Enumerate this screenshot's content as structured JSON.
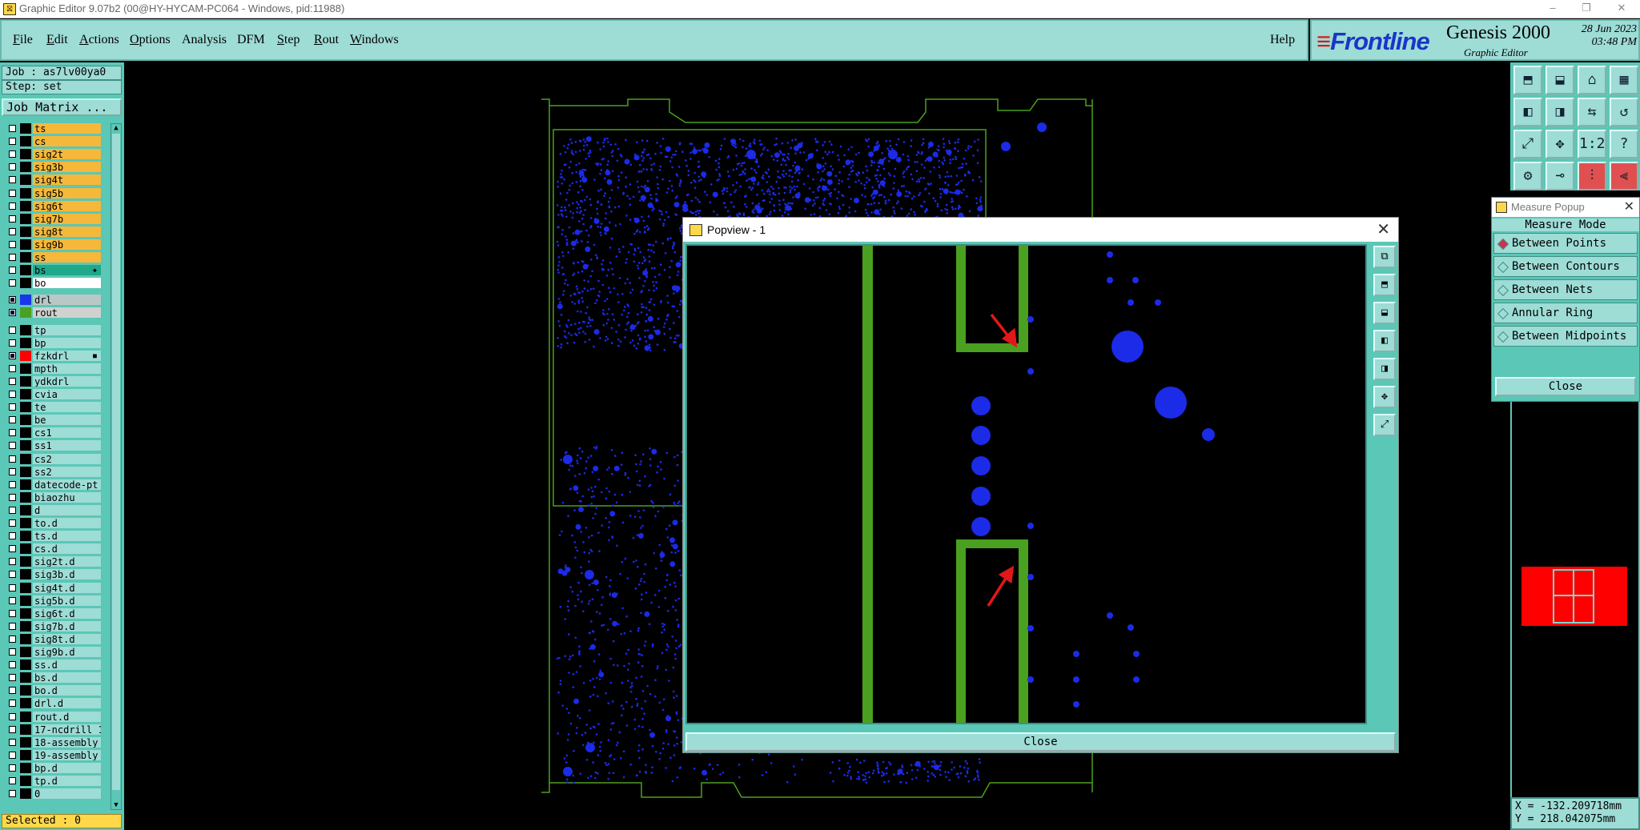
{
  "window": {
    "title": "Graphic Editor 9.07b2 (00@HY-HYCAM-PC064 - Windows, pid:11988)",
    "controls": [
      "–",
      "❐",
      "✕"
    ]
  },
  "menu": {
    "items": [
      {
        "label": "File",
        "underline": "F",
        "rest": "ile"
      },
      {
        "label": "Edit",
        "underline": "E",
        "rest": "dit"
      },
      {
        "label": "Actions",
        "underline": "A",
        "rest": "ctions"
      },
      {
        "label": "Options",
        "underline": "O",
        "rest": "ptions"
      },
      {
        "label": "Analysis",
        "underline": "",
        "rest": "Analysis"
      },
      {
        "label": "DFM",
        "underline": "",
        "rest": "DFM"
      },
      {
        "label": "Step",
        "underline": "S",
        "rest": "tep"
      },
      {
        "label": "Rout",
        "underline": "R",
        "rest": "out"
      },
      {
        "label": "Windows",
        "underline": "W",
        "rest": "indows"
      }
    ],
    "help": "Help"
  },
  "brand": {
    "logo": "Frontline",
    "product": "Genesis 2000",
    "subtitle": "Graphic Editor",
    "date": "28 Jun 2023",
    "time": "03:48 PM"
  },
  "left_panel": {
    "job": "Job : as7lv00ya0",
    "step": "Step: set",
    "job_matrix": "Job Matrix ...",
    "selected": "Selected : 0",
    "layers": [
      {
        "name": "ts",
        "color": "#f5b83a",
        "swatch": "#000000"
      },
      {
        "name": "cs",
        "color": "#f5b83a",
        "swatch": "#000000"
      },
      {
        "name": "sig2t",
        "color": "#f5b83a",
        "swatch": "#000000"
      },
      {
        "name": "sig3b",
        "color": "#f5b83a",
        "swatch": "#000000"
      },
      {
        "name": "sig4t",
        "color": "#f5b83a",
        "swatch": "#000000"
      },
      {
        "name": "sig5b",
        "color": "#f5b83a",
        "swatch": "#000000"
      },
      {
        "name": "sig6t",
        "color": "#f5b83a",
        "swatch": "#000000"
      },
      {
        "name": "sig7b",
        "color": "#f5b83a",
        "swatch": "#000000"
      },
      {
        "name": "sig8t",
        "color": "#f5b83a",
        "swatch": "#000000"
      },
      {
        "name": "sig9b",
        "color": "#f5b83a",
        "swatch": "#000000"
      },
      {
        "name": "ss",
        "color": "#f5b83a",
        "swatch": "#000000"
      },
      {
        "name": "bs",
        "color": "#1fa88a",
        "swatch": "#000000",
        "marker": "◆"
      },
      {
        "name": "bo",
        "color": "#ffffff",
        "swatch": "#000000"
      },
      {
        "name": "drl",
        "color": "#b9c8c6",
        "swatch": "#1b35e8",
        "checked": true,
        "gap": true
      },
      {
        "name": "rout",
        "color": "#cfd2cf",
        "swatch": "#4aa020",
        "checked": true
      },
      {
        "name": "tp",
        "color": "#9edcd6",
        "swatch": "#000000",
        "gap": true
      },
      {
        "name": "bp",
        "color": "#9edcd6",
        "swatch": "#000000"
      },
      {
        "name": "fzkdrl",
        "color": "#9edcd6",
        "swatch": "#ff0000",
        "checked": true,
        "marker": "■"
      },
      {
        "name": "mpth",
        "color": "#9edcd6",
        "swatch": "#000000"
      },
      {
        "name": "ydkdrl",
        "color": "#9edcd6",
        "swatch": "#000000"
      },
      {
        "name": "cvia",
        "color": "#9edcd6",
        "swatch": "#000000"
      },
      {
        "name": "te",
        "color": "#9edcd6",
        "swatch": "#000000"
      },
      {
        "name": "be",
        "color": "#9edcd6",
        "swatch": "#000000"
      },
      {
        "name": "cs1",
        "color": "#9edcd6",
        "swatch": "#000000"
      },
      {
        "name": "ss1",
        "color": "#9edcd6",
        "swatch": "#000000"
      },
      {
        "name": "cs2",
        "color": "#9edcd6",
        "swatch": "#000000"
      },
      {
        "name": "ss2",
        "color": "#9edcd6",
        "swatch": "#000000"
      },
      {
        "name": "datecode-pt",
        "color": "#9edcd6",
        "swatch": "#000000"
      },
      {
        "name": "biaozhu",
        "color": "#9edcd6",
        "swatch": "#000000"
      },
      {
        "name": "d",
        "color": "#9edcd6",
        "swatch": "#000000"
      },
      {
        "name": "to.d",
        "color": "#9edcd6",
        "swatch": "#000000"
      },
      {
        "name": "ts.d",
        "color": "#9edcd6",
        "swatch": "#000000"
      },
      {
        "name": "cs.d",
        "color": "#9edcd6",
        "swatch": "#000000"
      },
      {
        "name": "sig2t.d",
        "color": "#9edcd6",
        "swatch": "#000000"
      },
      {
        "name": "sig3b.d",
        "color": "#9edcd6",
        "swatch": "#000000"
      },
      {
        "name": "sig4t.d",
        "color": "#9edcd6",
        "swatch": "#000000"
      },
      {
        "name": "sig5b.d",
        "color": "#9edcd6",
        "swatch": "#000000"
      },
      {
        "name": "sig6t.d",
        "color": "#9edcd6",
        "swatch": "#000000"
      },
      {
        "name": "sig7b.d",
        "color": "#9edcd6",
        "swatch": "#000000"
      },
      {
        "name": "sig8t.d",
        "color": "#9edcd6",
        "swatch": "#000000"
      },
      {
        "name": "sig9b.d",
        "color": "#9edcd6",
        "swatch": "#000000"
      },
      {
        "name": "ss.d",
        "color": "#9edcd6",
        "swatch": "#000000"
      },
      {
        "name": "bs.d",
        "color": "#9edcd6",
        "swatch": "#000000"
      },
      {
        "name": "bo.d",
        "color": "#9edcd6",
        "swatch": "#000000"
      },
      {
        "name": "drl.d",
        "color": "#9edcd6",
        "swatch": "#000000"
      },
      {
        "name": "rout.d",
        "color": "#9edcd6",
        "swatch": "#000000"
      },
      {
        "name": "17-ncdrill_1",
        "color": "#9edcd6",
        "swatch": "#000000"
      },
      {
        "name": "18-assembly",
        "color": "#9edcd6",
        "swatch": "#000000"
      },
      {
        "name": "19-assembly",
        "color": "#9edcd6",
        "swatch": "#000000"
      },
      {
        "name": "bp.d",
        "color": "#9edcd6",
        "swatch": "#000000"
      },
      {
        "name": "tp.d",
        "color": "#9edcd6",
        "swatch": "#000000"
      },
      {
        "name": "0",
        "color": "#9edcd6",
        "swatch": "#000000"
      }
    ]
  },
  "toolbar": {
    "icons": [
      "zoom-home-icon",
      "zoom-fit-icon",
      "home-icon",
      "grid-icon",
      "pan-left-icon",
      "pan-right-icon",
      "zoom-prev-icon",
      "redraw-icon",
      "fit-screen-icon",
      "center-icon",
      "scale-icon",
      "help-icon",
      "settings-icon",
      "measure-icon",
      "snap-icon",
      "layers-icon"
    ],
    "glyphs": [
      "⬒",
      "⬓",
      "⌂",
      "▦",
      "◧",
      "◨",
      "⇆",
      "↺",
      "⤢",
      "✥",
      "1:2",
      "?",
      "⚙",
      "⊸",
      "⫶",
      "⫷"
    ]
  },
  "measure_popup": {
    "title": "Measure Popup",
    "mode_title": "Measure Mode",
    "options": [
      "Between Points",
      "Between Contours",
      "Between Nets",
      "Annular Ring",
      "Between Midpoints"
    ],
    "selected": "Between Points",
    "close": "Close"
  },
  "popview": {
    "title": "Popview - 1",
    "close": "Close",
    "tool_glyphs": [
      "⧉",
      "⬒",
      "⬓",
      "◧",
      "◨",
      "✥",
      "⤢"
    ]
  },
  "status": {
    "x": "X = -132.209718mm",
    "y": "Y = 218.042075mm"
  },
  "colors": {
    "panel": "#9edcd6",
    "panel_dark": "#5bc7b6",
    "copper_dot": "#1b2be8",
    "rout_line": "#4aa020",
    "annotation_arrow": "#e01818"
  }
}
